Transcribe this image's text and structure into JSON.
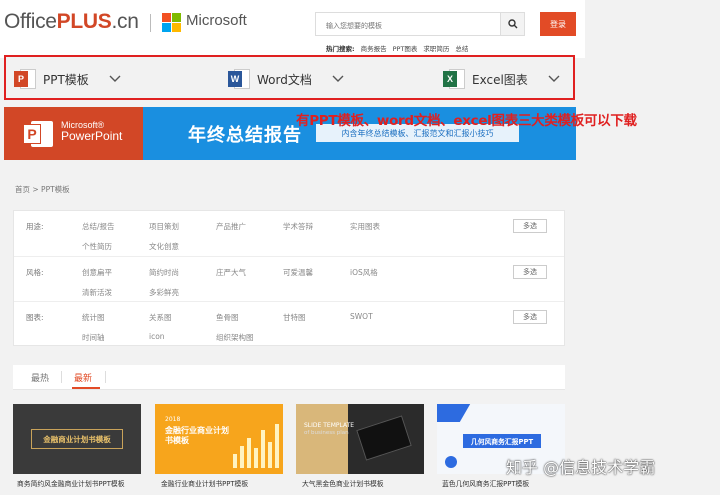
{
  "header": {
    "logo_office": "Office",
    "logo_plus": "PLUS",
    "logo_cn": ".cn",
    "ms_text": "Microsoft",
    "search_placeholder": "输入您想要的模板",
    "login": "登录",
    "hot_label": "热门搜索:",
    "hot_items": [
      "商务报告",
      "PPT图表",
      "求职简历",
      "总结"
    ]
  },
  "categories": [
    {
      "label": "PPT模板",
      "icon_letter": "P",
      "color": "#d24726",
      "icon": "powerpoint-icon"
    },
    {
      "label": "Word文档",
      "icon_letter": "W",
      "color": "#2b579a",
      "icon": "word-icon"
    },
    {
      "label": "Excel图表",
      "icon_letter": "X",
      "color": "#217346",
      "icon": "excel-icon"
    }
  ],
  "annotation": "有PPT模板、word文档、excel图表三大类模板可以下载",
  "banner": {
    "brand_line1": "Microsoft®",
    "brand_line2": "PowerPoint",
    "title": "年终总结报告",
    "subtitle": "内含年终总结模板、汇报范文和汇报小技巧"
  },
  "breadcrumb": "首页 > PPT模板",
  "filters": [
    {
      "label": "用途:",
      "options": [
        "总结/报告",
        "项目策划",
        "产品推广",
        "学术答辩",
        "实用图表",
        "个性简历",
        "文化创意"
      ],
      "more": "多选"
    },
    {
      "label": "风格:",
      "options": [
        "创意扁平",
        "简约时尚",
        "庄严大气",
        "可爱温馨",
        "iOS风格",
        "清新活泼",
        "多彩鲜亮"
      ],
      "more": "多选"
    },
    {
      "label": "图表:",
      "options": [
        "统计图",
        "关系图",
        "鱼骨图",
        "甘特图",
        "SWOT",
        "时间轴",
        "icon",
        "组织架构图"
      ],
      "more": "多选"
    }
  ],
  "tabs": [
    "最热",
    "最新"
  ],
  "cards": [
    {
      "title": "商务简约风金融商业计划书PPT模板",
      "thumb_text": "金融商业计划书模板"
    },
    {
      "title": "金融行业商业计划书PPT模板",
      "thumb_text": "金融行业商业计划书模板",
      "thumb_year": "2018"
    },
    {
      "title": "大气黑金色商业计划书模板",
      "thumb_text": "SLIDE TEMPLATE",
      "thumb_sub": "of business plan"
    },
    {
      "title": "蓝色几何风商务汇报PPT模板",
      "thumb_text": "几何风商务汇报PPT"
    }
  ],
  "watermark": "知乎 @信息技术学霸",
  "colors": {
    "accent": "#e24b26",
    "banner_blue": "#1a8fe0",
    "annotation_red": "#e02020"
  }
}
